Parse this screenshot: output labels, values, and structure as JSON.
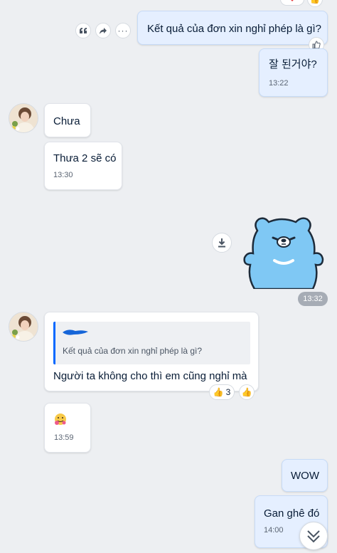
{
  "messages": {
    "m1": {
      "text": "Kết quả của đơn xin nghỉ phép là gì?"
    },
    "m2": {
      "text": "잘 된거야?",
      "time": "13:22"
    },
    "m3": {
      "text": "Chưa"
    },
    "m4": {
      "text": "Thưa 2 sẽ có",
      "time": "13:30"
    },
    "sticker": {
      "time": "13:32"
    },
    "m5": {
      "quote_text": "Kết quả của đơn xin nghỉ phép là gì?",
      "text": "Người ta không cho thì em cũng nghỉ mà",
      "reaction_count": "3"
    },
    "m6": {
      "time": "13:59"
    },
    "m7": {
      "text": "WOW"
    },
    "m8": {
      "text": "Gan ghê đó",
      "time": "14:00"
    }
  },
  "colors": {
    "my_bubble": "#e5efff",
    "their_bubble": "#ffffff",
    "background": "#edeff2",
    "sticker_blue": "#7fc8f4",
    "quote_bar": "#0068ff"
  },
  "icons": [
    "quote-icon",
    "share-icon",
    "more-icon",
    "like-icon",
    "download-icon",
    "thumbs-up-icon",
    "heart-icon",
    "scroll-down-icon"
  ]
}
